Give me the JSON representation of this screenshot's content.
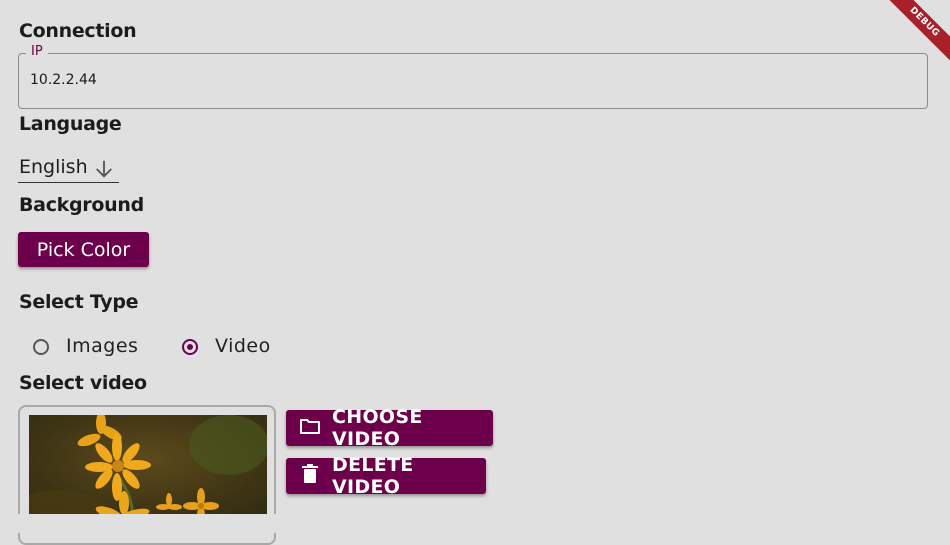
{
  "connection": {
    "title": "Connection",
    "ip_label": "IP",
    "ip_value": "10.2.2.44"
  },
  "language": {
    "title": "Language",
    "selected": "English",
    "icon": "arrow-down-icon"
  },
  "background": {
    "title": "Background",
    "pick_color_label": "Pick Color"
  },
  "select_type": {
    "title": "Select Type",
    "options": [
      {
        "label": "Images",
        "selected": false
      },
      {
        "label": "Video",
        "selected": true
      }
    ]
  },
  "select_video": {
    "title": "Select video",
    "choose_label": "CHOOSE VIDEO",
    "choose_icon": "folder-icon",
    "delete_label": "DELETE VIDEO",
    "delete_icon": "trash-icon"
  },
  "debug_banner": "DEBUG",
  "colors": {
    "accent": "#6d004a",
    "background": "#e0e0e0",
    "debug_banner": "#a8202a"
  }
}
